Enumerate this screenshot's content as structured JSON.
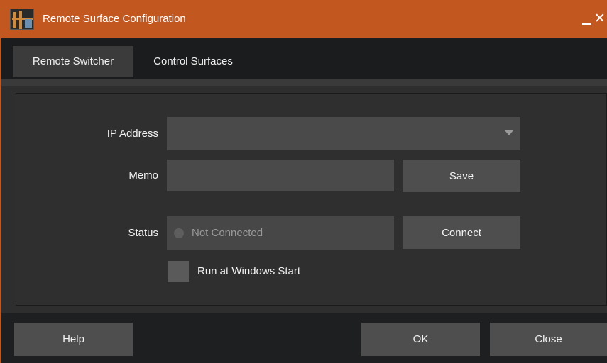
{
  "window": {
    "title": "Remote Surface Configuration",
    "accent_color": "#c2571f",
    "icons": {
      "app": "app-logo-icon",
      "minimize": "minimize-icon",
      "close": "close-icon"
    },
    "close_glyph": "✕"
  },
  "tabs": [
    {
      "label": "Remote Switcher",
      "active": true
    },
    {
      "label": "Control Surfaces",
      "active": false
    }
  ],
  "form": {
    "ip_address": {
      "label": "IP Address",
      "value": ""
    },
    "memo": {
      "label": "Memo",
      "value": "",
      "save_label": "Save"
    },
    "status": {
      "label": "Status",
      "value": "Not Connected",
      "connect_label": "Connect"
    },
    "run_at_start": {
      "label": "Run at Windows Start",
      "checked": false
    }
  },
  "footer": {
    "help_label": "Help",
    "ok_label": "OK",
    "close_label": "Close"
  }
}
